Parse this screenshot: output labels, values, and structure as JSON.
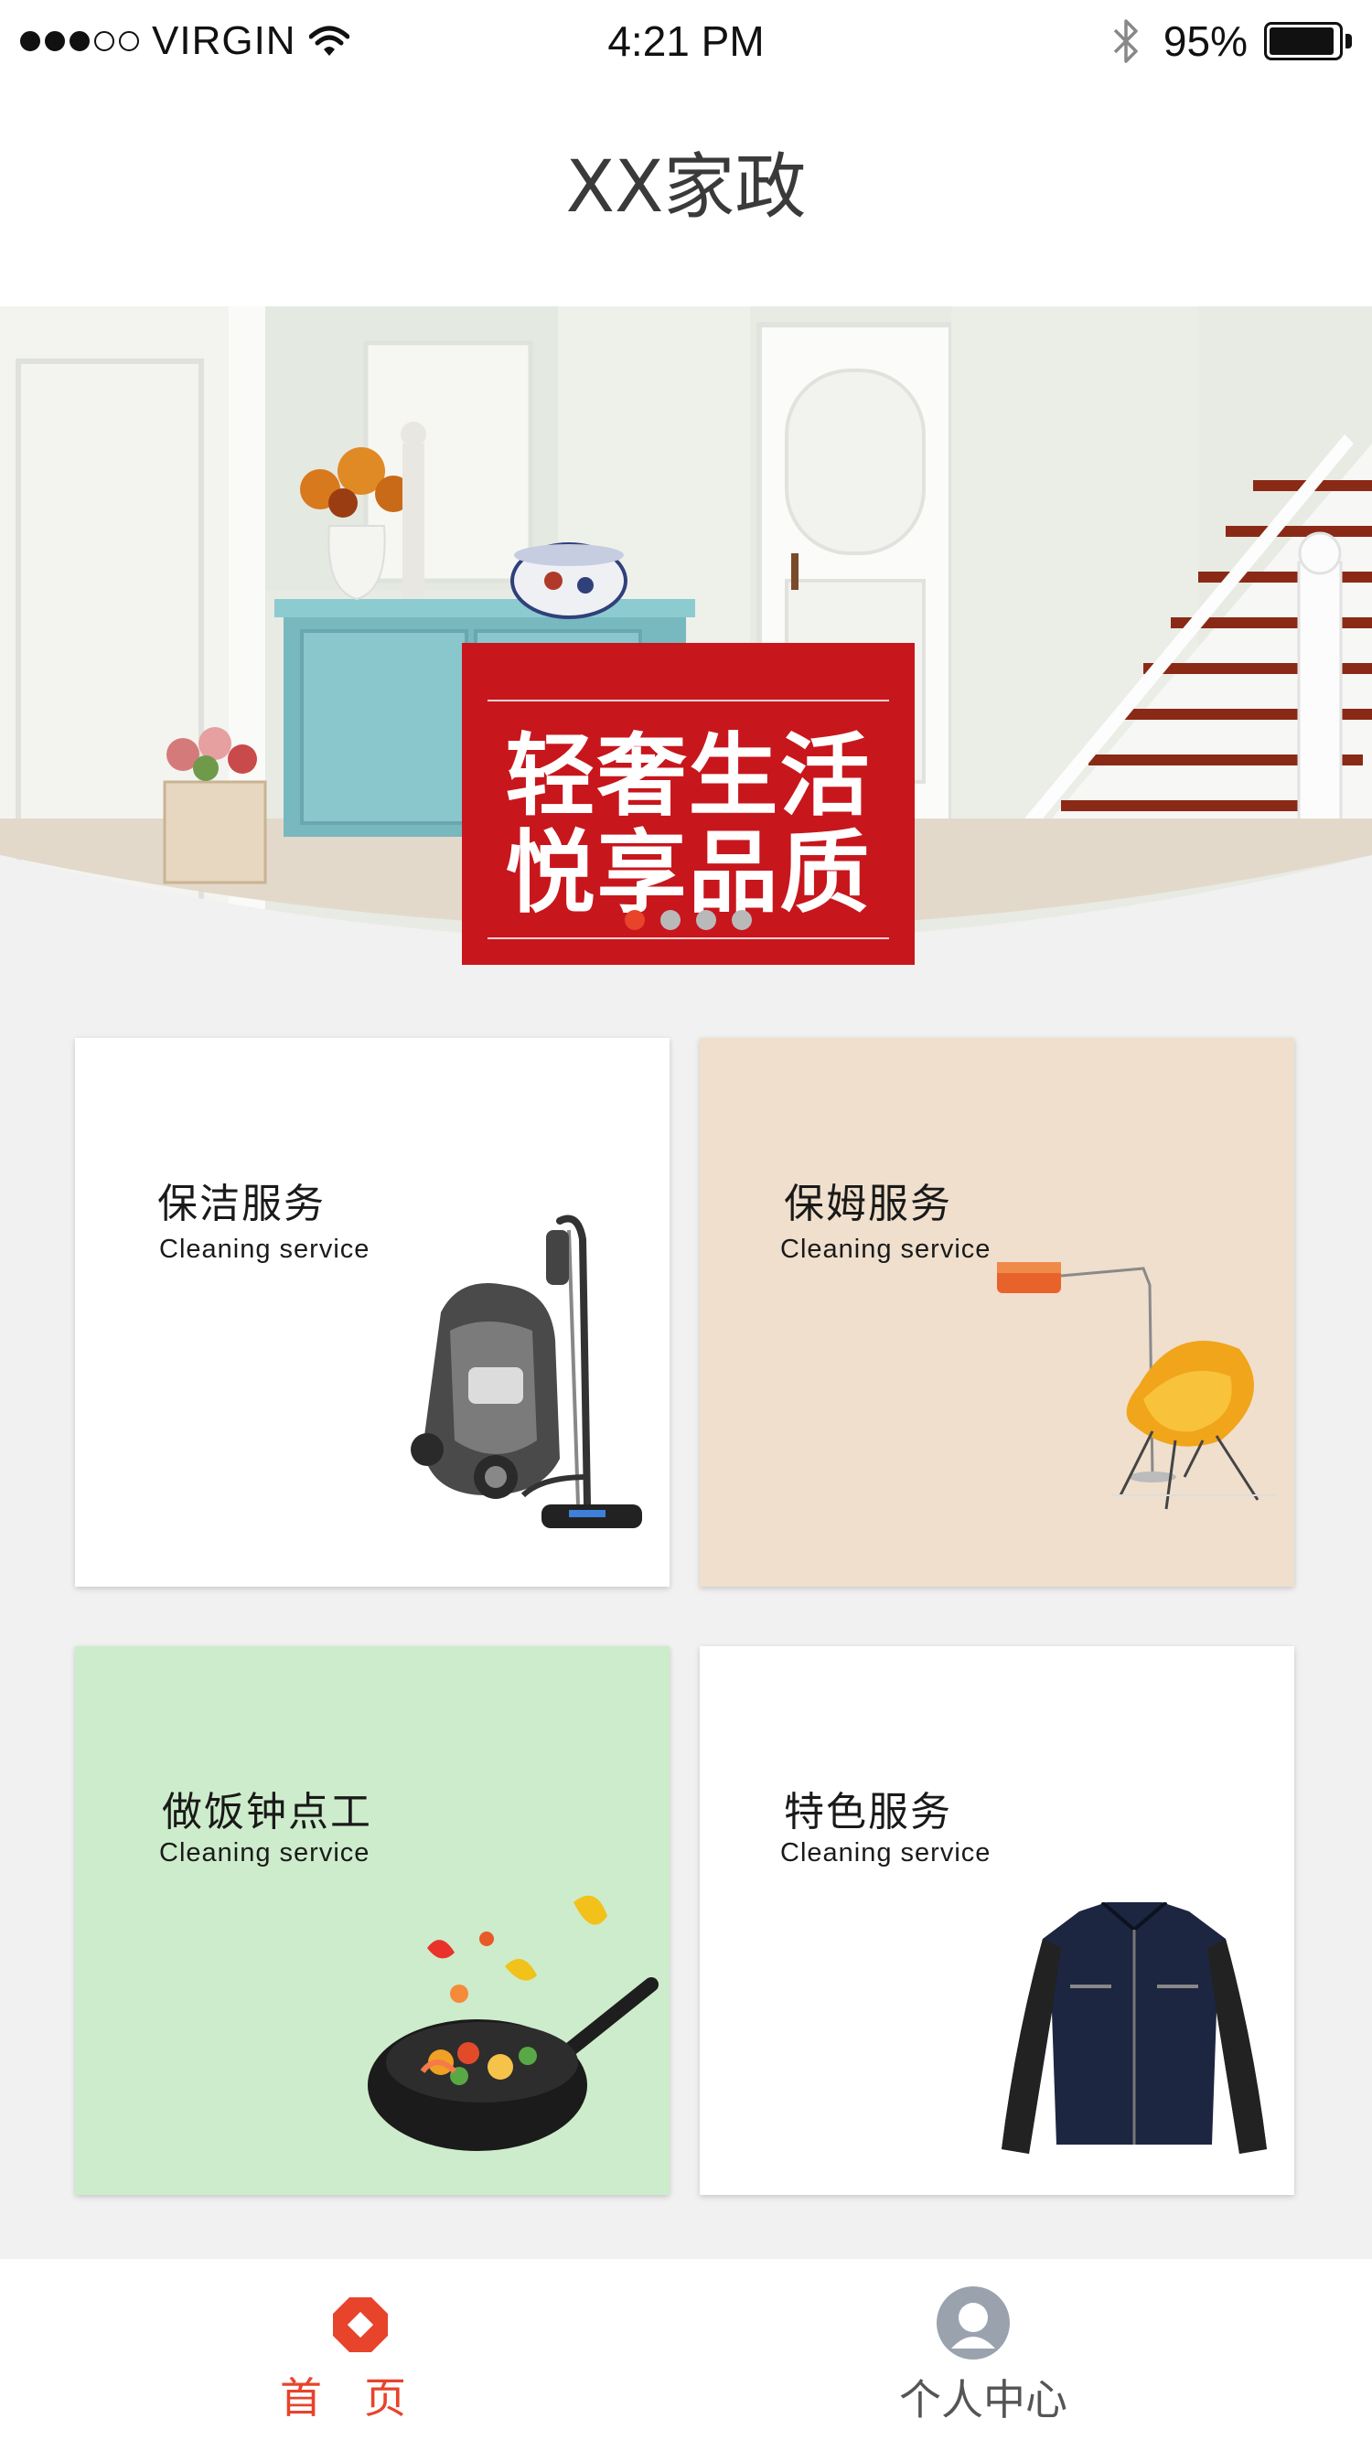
{
  "status_bar": {
    "carrier": "VIRGIN",
    "time": "4:21 PM",
    "battery": "95%",
    "signal_bars": 3,
    "signal_total": 5
  },
  "nav": {
    "title": "XX家政"
  },
  "banner": {
    "line1": "轻奢生活",
    "line2": "悦享品质",
    "slide_count": 4,
    "active_slide": 1,
    "accent_color": "#c8161d"
  },
  "services": [
    {
      "title": "保洁服务",
      "subtitle": "Cleaning service",
      "image": "vacuum-cleaner-icon",
      "bg": "#ffffff"
    },
    {
      "title": "保姆服务",
      "subtitle": "Cleaning service",
      "image": "chair-lamp-icon",
      "bg": "#efdfcc"
    },
    {
      "title": "做饭钟点工",
      "subtitle": "Cleaning service",
      "image": "wok-icon",
      "bg": "#cdeccb"
    },
    {
      "title": "特色服务",
      "subtitle": "Cleaning service",
      "image": "jacket-icon",
      "bg": "#ffffff"
    }
  ],
  "tabs": [
    {
      "label": "首　页",
      "icon": "home-icon",
      "active": true,
      "color": "#e8432b"
    },
    {
      "label": "个人中心",
      "icon": "profile-icon",
      "active": false,
      "color": "#555555"
    }
  ]
}
